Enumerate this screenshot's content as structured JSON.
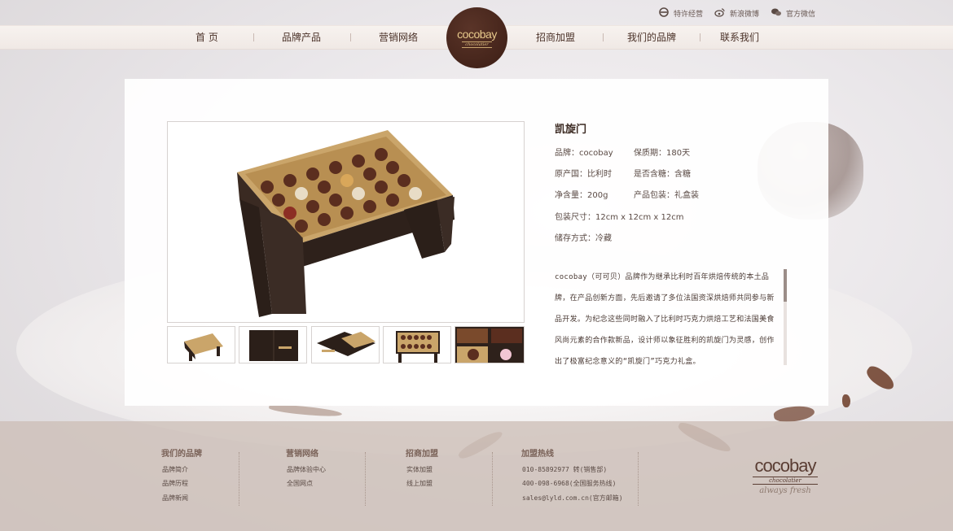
{
  "top_links": [
    {
      "label": "特许经营",
      "icon": "ie-icon"
    },
    {
      "label": "新浪微博",
      "icon": "weibo-icon"
    },
    {
      "label": "官方微信",
      "icon": "wechat-icon"
    }
  ],
  "nav": {
    "items": [
      "首 页",
      "品牌产品",
      "营销网络",
      "招商加盟",
      "我们的品牌",
      "联系我们"
    ],
    "logo": {
      "name": "cocobay",
      "sub": "chocolatier"
    }
  },
  "product": {
    "title": "凯旋门",
    "specs": {
      "brand": "品牌：cocobay",
      "shelf_life": "保质期：180天",
      "origin": "原产国：比利时",
      "sugar": "是否含糖：含糖",
      "weight": "净含量：200g",
      "packaging": "产品包装：礼盒装",
      "size": "包装尺寸：12cm x 12cm x 12cm",
      "storage": "储存方式：冷藏"
    },
    "description": "cocobay（可可贝）品牌作为继承比利时百年烘焙传统的本土品牌，在产品创新方面，先后邀请了多位法国资深烘焙师共同参与新品开发。为纪念这些同时融入了比利时巧克力烘焙工艺和法国美食风尚元素的合作款新品，设计师以象征胜利的凯旋门为灵感，创作出了极富纪念意义的“凯旋门”巧克力礼盒。",
    "thumbnails": [
      "open-box-thumb",
      "closed-box-thumb",
      "sliding-box-thumb",
      "tray-box-thumb",
      "closeup-thumb"
    ]
  },
  "footer": {
    "columns": [
      {
        "title": "我们的品牌",
        "links": [
          "品牌简介",
          "品牌历程",
          "品牌新闻"
        ]
      },
      {
        "title": "营销网络",
        "links": [
          "品牌体验中心",
          "全国网点"
        ]
      },
      {
        "title": "招商加盟",
        "links": [
          "实体加盟",
          "线上加盟"
        ]
      },
      {
        "title": "加盟热线",
        "lines": [
          "010-85892977 转(销售部)",
          "400-098-6968(全国服务热线)",
          "sales@lyld.com.cn(官方邮箱)"
        ]
      }
    ],
    "logo": {
      "name": "cocobay",
      "sub": "chocolatier",
      "tagline": "always fresh"
    }
  },
  "colors": {
    "brand_brown": "#3c1e15",
    "gold": "#e7c98b",
    "footer_bg": "#cdbfb7"
  }
}
